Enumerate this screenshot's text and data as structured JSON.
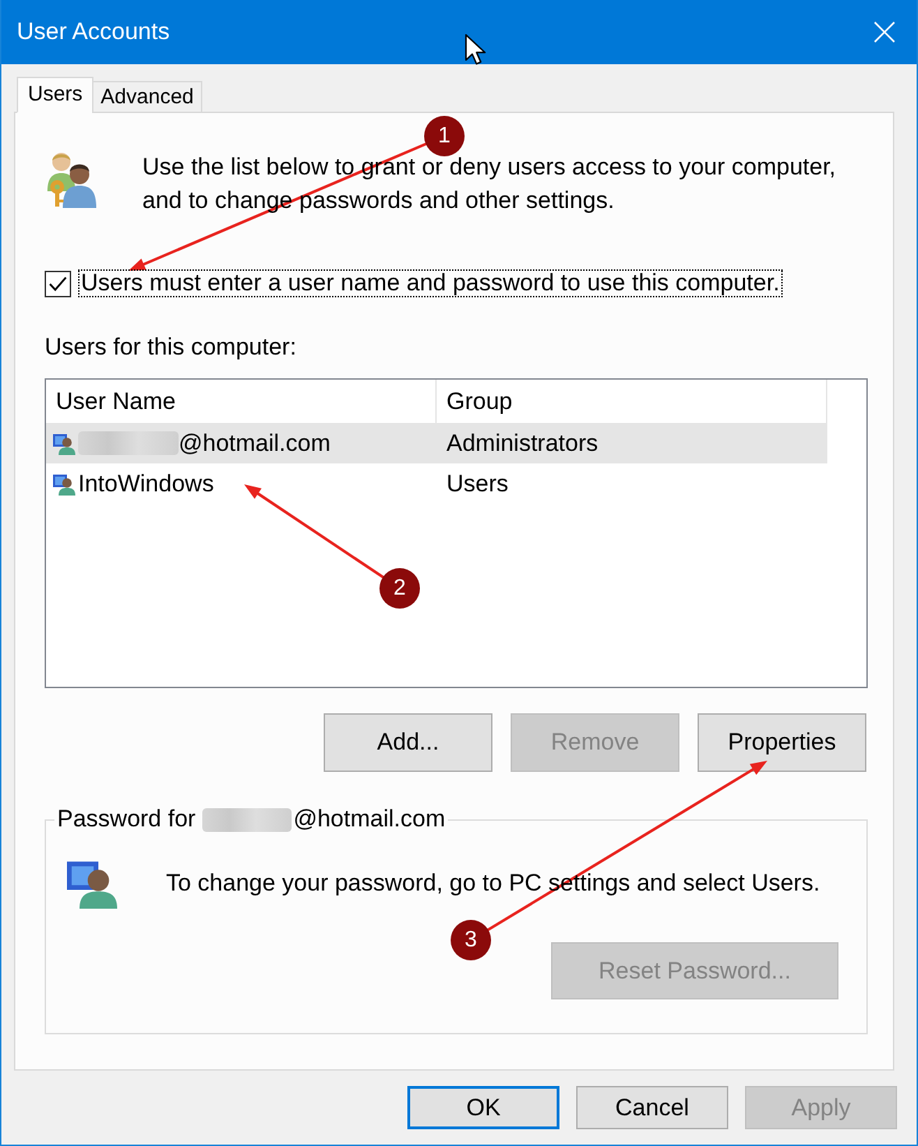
{
  "window": {
    "title": "User Accounts"
  },
  "tabs": [
    {
      "label": "Users",
      "selected": true
    },
    {
      "label": "Advanced",
      "selected": false
    }
  ],
  "intro": "Use the list below to grant or deny users access to your computer, and to change passwords and other settings.",
  "require_login": {
    "label": "Users must enter a user name and password to use this computer.",
    "checked": true,
    "focused": true
  },
  "users_list": {
    "label": "Users for this computer:",
    "columns": [
      "User Name",
      "Group"
    ],
    "rows": [
      {
        "user_name": "@hotmail.com",
        "redacted": true,
        "group": "Administrators",
        "selected": true
      },
      {
        "user_name": "IntoWindows",
        "redacted": false,
        "group": "Users",
        "selected": false
      }
    ]
  },
  "list_buttons": [
    {
      "label": "Add...",
      "disabled": false
    },
    {
      "label": "Remove",
      "disabled": true
    },
    {
      "label": "Properties",
      "disabled": false
    }
  ],
  "password_group": {
    "legend": "Password for",
    "account": "@hotmail.com",
    "redacted": true,
    "message": "To change your password, go to PC settings and select Users.",
    "reset_button": {
      "label": "Reset Password...",
      "disabled": true
    }
  },
  "dialog_buttons": [
    {
      "label": "OK",
      "default": true,
      "disabled": false
    },
    {
      "label": "Cancel",
      "default": false,
      "disabled": false
    },
    {
      "label": "Apply",
      "default": false,
      "disabled": true
    }
  ],
  "annotations": [
    {
      "number": "1"
    },
    {
      "number": "2"
    },
    {
      "number": "3"
    }
  ]
}
